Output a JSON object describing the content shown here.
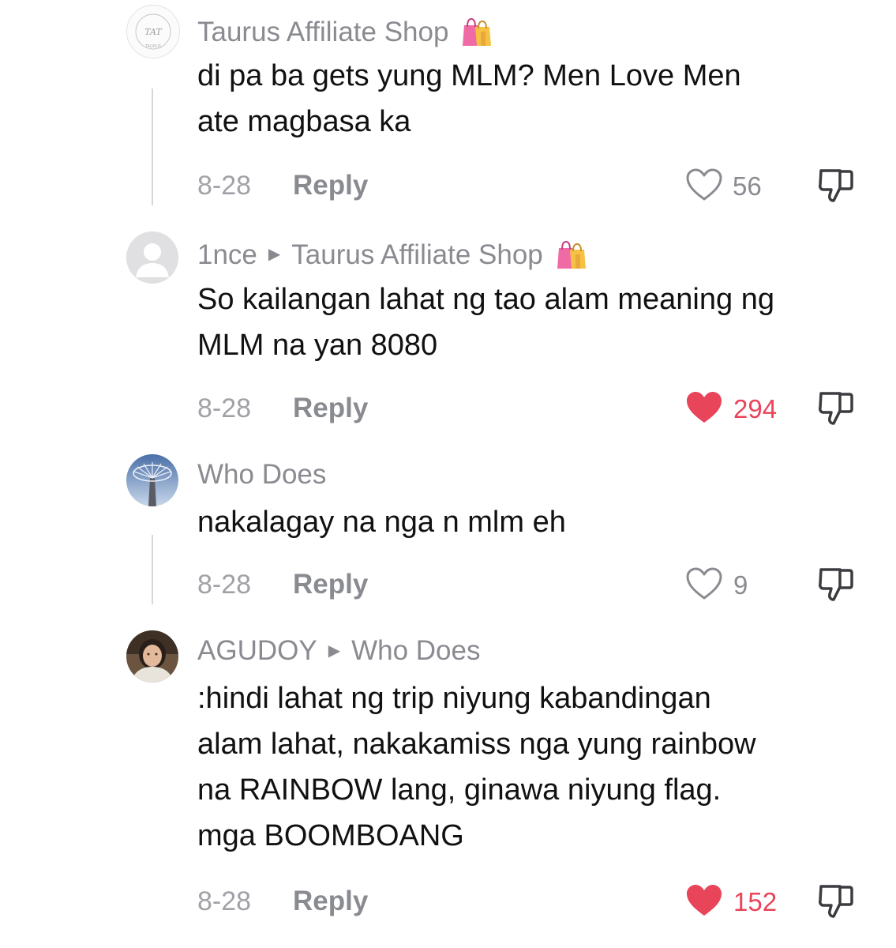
{
  "comments": [
    {
      "user": "Taurus Affiliate Shop",
      "reply_to": "",
      "text_lines": [
        "di pa ba gets yung MLM? Men Love Men",
        "ate magbasa ka"
      ],
      "date": "8-28",
      "reply_label": "Reply",
      "likes": "56",
      "liked": false,
      "avatar": "taurus-logo-icon",
      "badge": "shopping-bags-icon"
    },
    {
      "user": "1nce",
      "reply_to": "Taurus Affiliate Shop",
      "text_lines": [
        "So kailangan lahat ng tao alam meaning ng",
        "MLM na yan 8080"
      ],
      "date": "8-28",
      "reply_label": "Reply",
      "likes": "294",
      "liked": true,
      "avatar": "default-avatar-icon",
      "badge": "shopping-bags-icon"
    },
    {
      "user": "Who Does",
      "reply_to": "",
      "text_lines": [
        "nakalagay na nga n mlm eh"
      ],
      "date": "8-28",
      "reply_label": "Reply",
      "likes": "9",
      "liked": false,
      "avatar": "tree-photo-avatar"
    },
    {
      "user": "AGUDOY",
      "reply_to": "Who Does",
      "text_lines": [
        ":hindi lahat ng trip niyung kabandingan",
        "alam lahat, nakakamiss nga yung rainbow",
        "na RAINBOW lang, ginawa niyung flag.",
        "mga BOOMBOANG"
      ],
      "date": "8-28",
      "reply_label": "Reply",
      "likes": "152",
      "liked": true,
      "avatar": "person-photo-avatar"
    }
  ],
  "colors": {
    "liked": "#e8445a",
    "muted": "#8a8b91",
    "text": "#111111"
  }
}
